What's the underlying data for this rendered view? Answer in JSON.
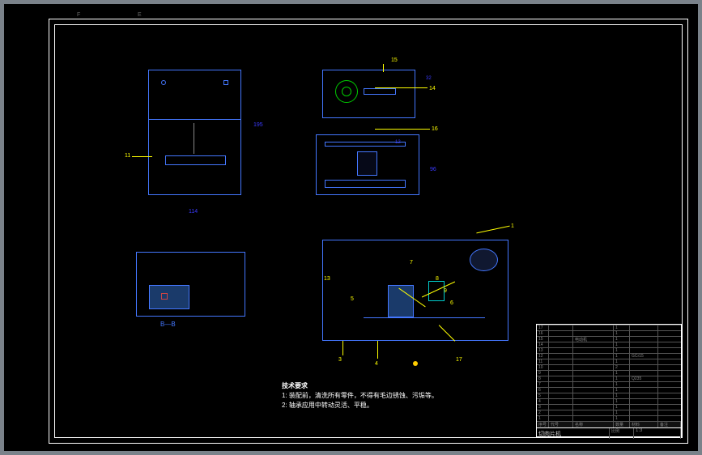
{
  "top_marks": {
    "f": "F",
    "e": "E"
  },
  "views": {
    "front": {
      "dims": {
        "height": "195",
        "width": "114"
      },
      "callouts": [
        "11"
      ]
    },
    "side_top": {
      "callouts": [
        "15",
        "16",
        "12",
        "14"
      ]
    },
    "side_bottom": {
      "callouts": [
        "17"
      ],
      "dim": "96"
    },
    "plan_left": {
      "section": "B—B"
    },
    "plan_right": {
      "callouts": [
        "1",
        "3",
        "4",
        "5",
        "6",
        "7",
        "8",
        "9",
        "13",
        "17"
      ]
    }
  },
  "notes": {
    "title": "技术要求",
    "line1": "1: 装配前，清洗所有零件，不得有毛边锈蚀、污垢等。",
    "line2": "2: 轴承应用中转动灵活、平稳。"
  },
  "title_block": {
    "rows": [
      [
        "17",
        "",
        "",
        "1",
        ""
      ],
      [
        "16",
        "",
        "",
        "1",
        ""
      ],
      [
        "15",
        "",
        "电动机",
        "1",
        ""
      ],
      [
        "14",
        "",
        "",
        "1",
        ""
      ],
      [
        "13",
        "",
        "",
        "1",
        ""
      ],
      [
        "12",
        "",
        "",
        "1",
        "GCr15"
      ],
      [
        "11",
        "",
        "",
        "1",
        ""
      ],
      [
        "10",
        "",
        "",
        "2",
        ""
      ],
      [
        "9",
        "",
        "",
        "1",
        ""
      ],
      [
        "8",
        "",
        "",
        "1",
        "Q235"
      ],
      [
        "7",
        "",
        "",
        "1",
        ""
      ],
      [
        "6",
        "",
        "",
        "1",
        ""
      ],
      [
        "5",
        "",
        "",
        "1",
        ""
      ],
      [
        "4",
        "",
        "",
        "1",
        ""
      ],
      [
        "3",
        "",
        "",
        "1",
        ""
      ],
      [
        "2",
        "",
        "",
        "1",
        ""
      ],
      [
        "1",
        "",
        "",
        "1",
        ""
      ]
    ],
    "header": [
      "序号",
      "代号",
      "名称",
      "数量",
      "材料",
      "备注"
    ],
    "project": "切肉片机",
    "scale_label": "比例",
    "scale": "1:3"
  }
}
